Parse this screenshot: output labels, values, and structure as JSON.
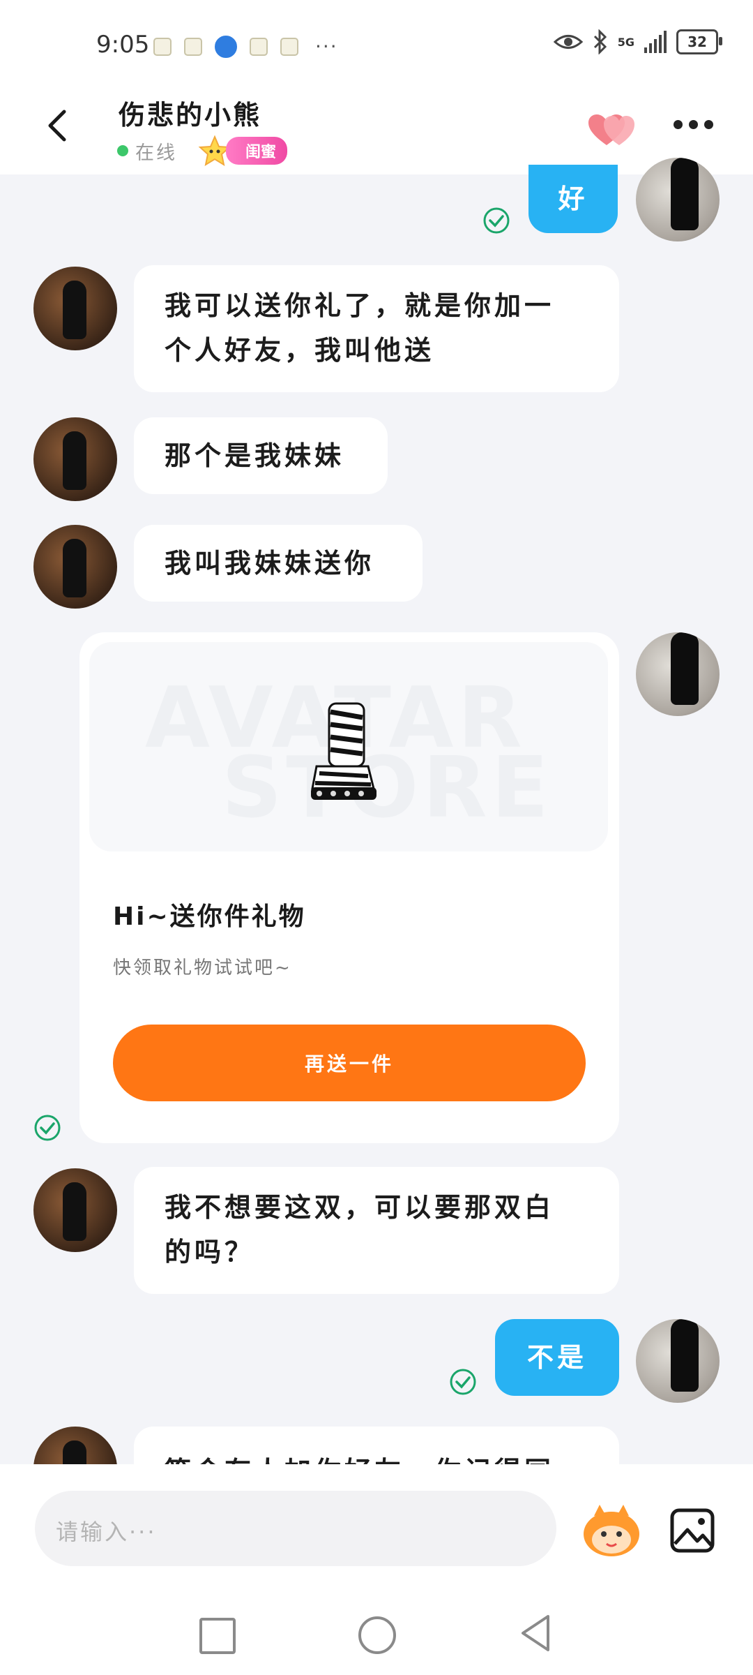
{
  "status_bar": {
    "time": "9:05",
    "more": "···",
    "network": "5G",
    "battery": "32"
  },
  "header": {
    "title": "伤悲的小熊",
    "online": "在线",
    "badge": "闺蜜"
  },
  "messages": [
    {
      "id": "m0",
      "from": "me",
      "text": "好"
    },
    {
      "id": "m1",
      "from": "other",
      "lines": [
        "我可以送你礼了，就是你加一",
        "个人好友，我叫他送"
      ]
    },
    {
      "id": "m2",
      "from": "other",
      "text": "那个是我妹妹"
    },
    {
      "id": "m3",
      "from": "other",
      "text": "我叫我妹妹送你"
    },
    {
      "id": "m5",
      "from": "other",
      "lines": [
        "我不想要这双，可以要那双白",
        "的吗？"
      ]
    },
    {
      "id": "m6",
      "from": "me",
      "text": "不是"
    },
    {
      "id": "m7",
      "from": "other",
      "text": "等会有人加你好友，你记得同"
    }
  ],
  "gift_card": {
    "watermark_top": "AVATAR",
    "watermark_bottom": "STORE",
    "title": "Hi~送你件礼物",
    "subtitle": "快领取礼物试试吧~",
    "button": "再送一件"
  },
  "input": {
    "placeholder": "请输入···"
  },
  "colors": {
    "bubble_blue": "#28b2f3",
    "button_orange": "#ff7614",
    "online_green": "#3cc76a",
    "badge_pink": "#f04aa4",
    "background": "#f3f4f8"
  },
  "icons": {
    "back": "chevron-left-icon",
    "hearts": "hearts-icon",
    "more": "more-dots-icon",
    "read": "check-circle-icon",
    "mascot": "mascot-emoji-icon",
    "image": "image-icon"
  }
}
